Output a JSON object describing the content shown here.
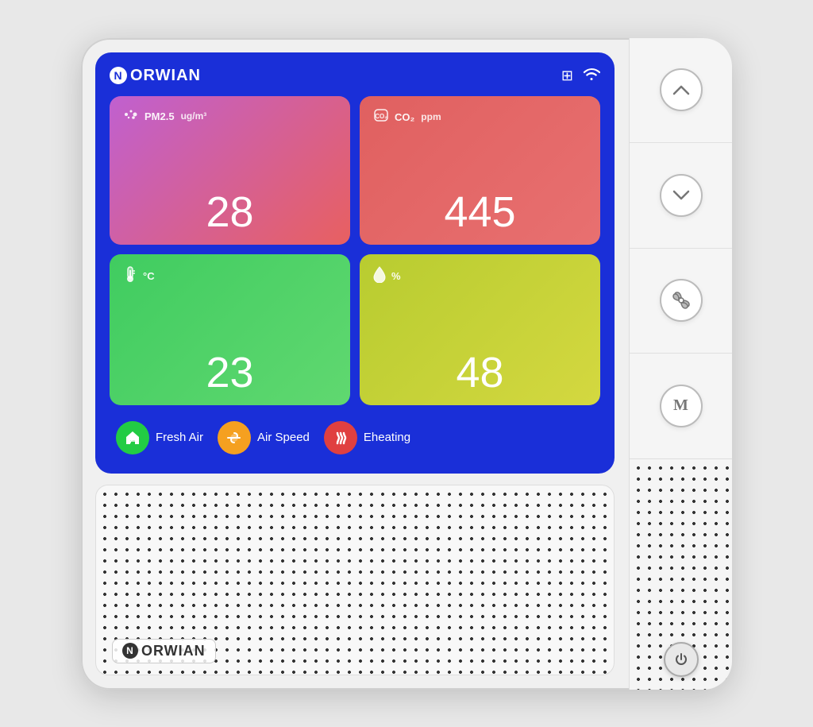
{
  "device": {
    "brand": "NORWIAN"
  },
  "screen": {
    "background_color": "#1a2fd8"
  },
  "sensors": [
    {
      "id": "pm25",
      "label": "PM2.5",
      "unit": "ug/m³",
      "value": "28",
      "card_class": "card-pm25"
    },
    {
      "id": "co2",
      "label": "CO₂",
      "unit": "ppm",
      "value": "445",
      "card_class": "card-co2"
    },
    {
      "id": "temperature",
      "label": "°C",
      "unit": "",
      "value": "23",
      "card_class": "card-temp"
    },
    {
      "id": "humidity",
      "label": "%",
      "unit": "",
      "value": "48",
      "card_class": "card-humid"
    }
  ],
  "controls": [
    {
      "id": "fresh-air",
      "label": "Fresh Air",
      "btn_class": "btn-green",
      "icon": "🏠"
    },
    {
      "id": "air-speed",
      "label": "Air Speed",
      "btn_class": "btn-orange",
      "icon": "💨"
    },
    {
      "id": "eheating",
      "label": "Eheating",
      "btn_class": "btn-red",
      "icon": "♨"
    }
  ],
  "side_buttons": [
    {
      "id": "up",
      "icon": "up-arrow",
      "label": "∧"
    },
    {
      "id": "down",
      "icon": "down-arrow",
      "label": "∨"
    },
    {
      "id": "fan",
      "icon": "fan",
      "label": "✿"
    },
    {
      "id": "mode",
      "icon": "mode",
      "label": "M"
    }
  ],
  "power_button": {
    "icon": "⏻"
  }
}
